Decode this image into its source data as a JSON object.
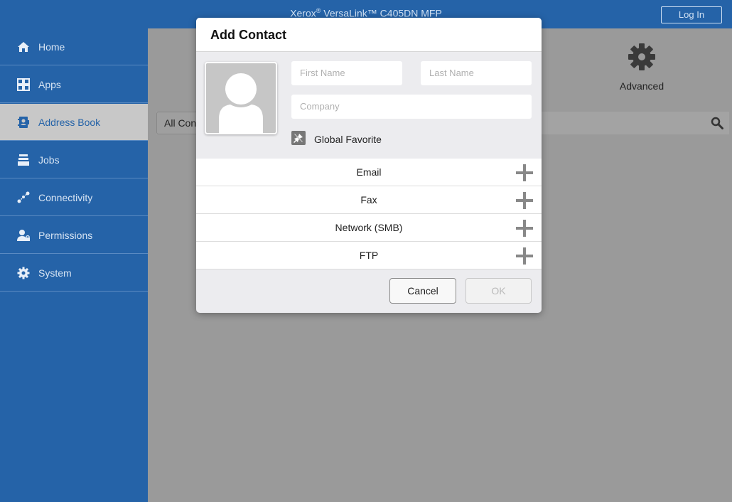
{
  "header": {
    "title_brand": "Xerox",
    "title_reg": "®",
    "title_product": " VersaLink™ C405DN MFP",
    "login_label": "Log In"
  },
  "sidebar": {
    "items": [
      {
        "label": "Home",
        "icon": "home-icon"
      },
      {
        "label": "Apps",
        "icon": "apps-grid-icon"
      },
      {
        "label": "Address Book",
        "icon": "address-book-icon",
        "active": true
      },
      {
        "label": "Jobs",
        "icon": "jobs-icon"
      },
      {
        "label": "Connectivity",
        "icon": "connectivity-icon"
      },
      {
        "label": "Permissions",
        "icon": "permissions-icon"
      },
      {
        "label": "System",
        "icon": "gear-icon"
      }
    ]
  },
  "main": {
    "advanced_label": "Advanced",
    "filter_selected": "All Contacts"
  },
  "dialog": {
    "title": "Add Contact",
    "first_name_placeholder": "First Name",
    "last_name_placeholder": "Last Name",
    "company_placeholder": "Company",
    "global_favorite_label": "Global Favorite",
    "rows": [
      {
        "label": "Email"
      },
      {
        "label": "Fax"
      },
      {
        "label": "Network (SMB)"
      },
      {
        "label": "FTP"
      }
    ],
    "cancel_label": "Cancel",
    "ok_label": "OK"
  },
  "colors": {
    "brand_blue": "#2563a8",
    "sidebar_active": "#c8c8c8",
    "main_bg": "#9a9a9a",
    "dialog_bg": "#ececef"
  }
}
